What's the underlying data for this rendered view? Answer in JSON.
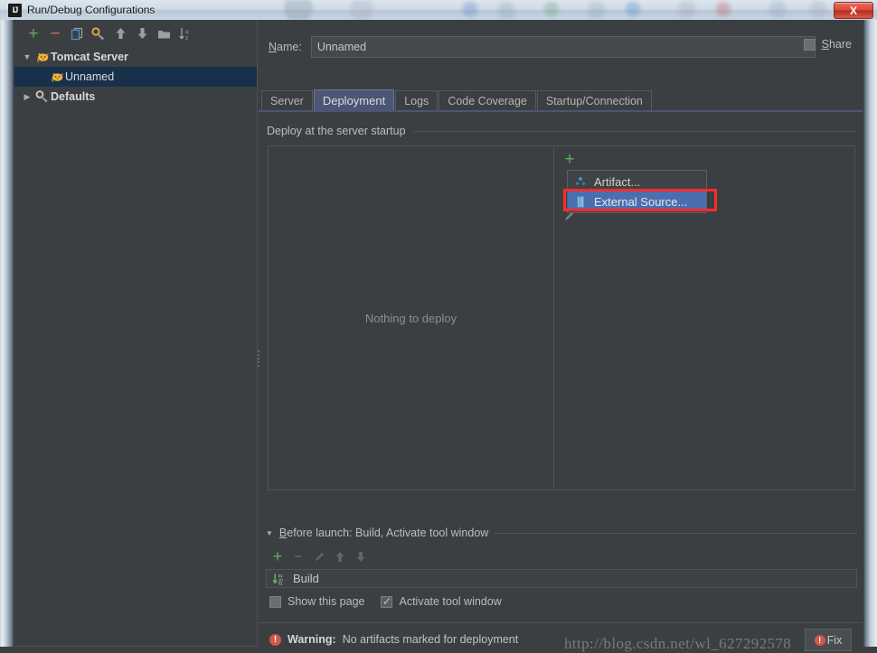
{
  "window": {
    "title": "Run/Debug Configurations",
    "logo_text": "IJ",
    "close_label": "X",
    "close_icon": "close-icon"
  },
  "tree_toolbar": {
    "items": [
      {
        "icon": "plus-icon",
        "label": "+"
      },
      {
        "icon": "minus-icon",
        "label": "−"
      },
      {
        "icon": "copy-icon",
        "label": ""
      },
      {
        "icon": "settings-wrench-icon",
        "label": ""
      },
      {
        "icon": "arrow-up-icon",
        "label": ""
      },
      {
        "icon": "arrow-down-icon",
        "label": ""
      },
      {
        "icon": "folder-icon",
        "label": ""
      },
      {
        "icon": "sort-alpha-icon",
        "label": ""
      }
    ]
  },
  "tree": {
    "items": [
      {
        "label": "Tomcat Server",
        "icon": "tomcat-cat-icon",
        "twisty": "▼",
        "level": 0,
        "selected": false,
        "bold": true
      },
      {
        "label": "Unnamed",
        "icon": "tomcat-cat-icon",
        "twisty": "",
        "level": 1,
        "selected": true,
        "bold": false
      },
      {
        "label": "Defaults",
        "icon": "settings-wrench-icon",
        "twisty": "▶",
        "level": 0,
        "selected": false,
        "bold": true
      }
    ]
  },
  "name_field": {
    "label": "Name:",
    "label_mnemonic": "N",
    "value": "Unnamed",
    "placeholder": ""
  },
  "share": {
    "label": "Share",
    "label_mnemonic": "S",
    "checked": false
  },
  "tabs": [
    {
      "label": "Server",
      "active": false
    },
    {
      "label": "Deployment",
      "active": true
    },
    {
      "label": "Logs",
      "active": false
    },
    {
      "label": "Code Coverage",
      "active": false
    },
    {
      "label": "Startup/Connection",
      "active": false
    }
  ],
  "deployment": {
    "group_title": "Deploy at the server startup",
    "empty_text": "Nothing to deploy",
    "side_toolbar": [
      {
        "icon": "plus-icon",
        "label": "+"
      },
      {
        "icon": "arrow-down-icon",
        "label": ""
      },
      {
        "icon": "pencil-edit-icon",
        "label": ""
      }
    ],
    "add_menu": {
      "items": [
        {
          "label": "Artifact...",
          "icon": "artifact-diamond-icon",
          "selected": false
        },
        {
          "label": "External Source...",
          "icon": "external-source-icon",
          "selected": true
        }
      ],
      "highlight_color": "#ff2b2b"
    }
  },
  "before_launch": {
    "title": "Before launch: Build, Activate tool window",
    "title_mnemonic": "B",
    "twisty": "▼",
    "toolbar": [
      {
        "icon": "plus-icon",
        "label": "+"
      },
      {
        "icon": "minus-icon",
        "label": "−"
      },
      {
        "icon": "pencil-edit-icon",
        "label": ""
      },
      {
        "icon": "arrow-up-icon",
        "label": ""
      },
      {
        "icon": "arrow-down-icon",
        "label": ""
      }
    ],
    "tasks": [
      {
        "label": "Build",
        "icon": "build-compile-icon"
      }
    ],
    "checkboxes": [
      {
        "label": "Show this page",
        "checked": false
      },
      {
        "label": "Activate tool window",
        "checked": true
      }
    ]
  },
  "status_bar": {
    "warning_icon": "warning-exclamation-icon",
    "warning_prefix": "Warning:",
    "warning_text": "No artifacts marked for deployment",
    "fix_label": "Fix",
    "watermark": "http://blog.csdn.net/wl_627292578"
  },
  "colors": {
    "accent_selection": "#4b6eaf",
    "tab_active": "#4a5673",
    "tree_selection": "#17314a",
    "plus_green": "#5fae5f",
    "warning_red": "#d2564b",
    "highlight_red": "#ff2b2b",
    "panel_bg": "#3c3f41"
  }
}
